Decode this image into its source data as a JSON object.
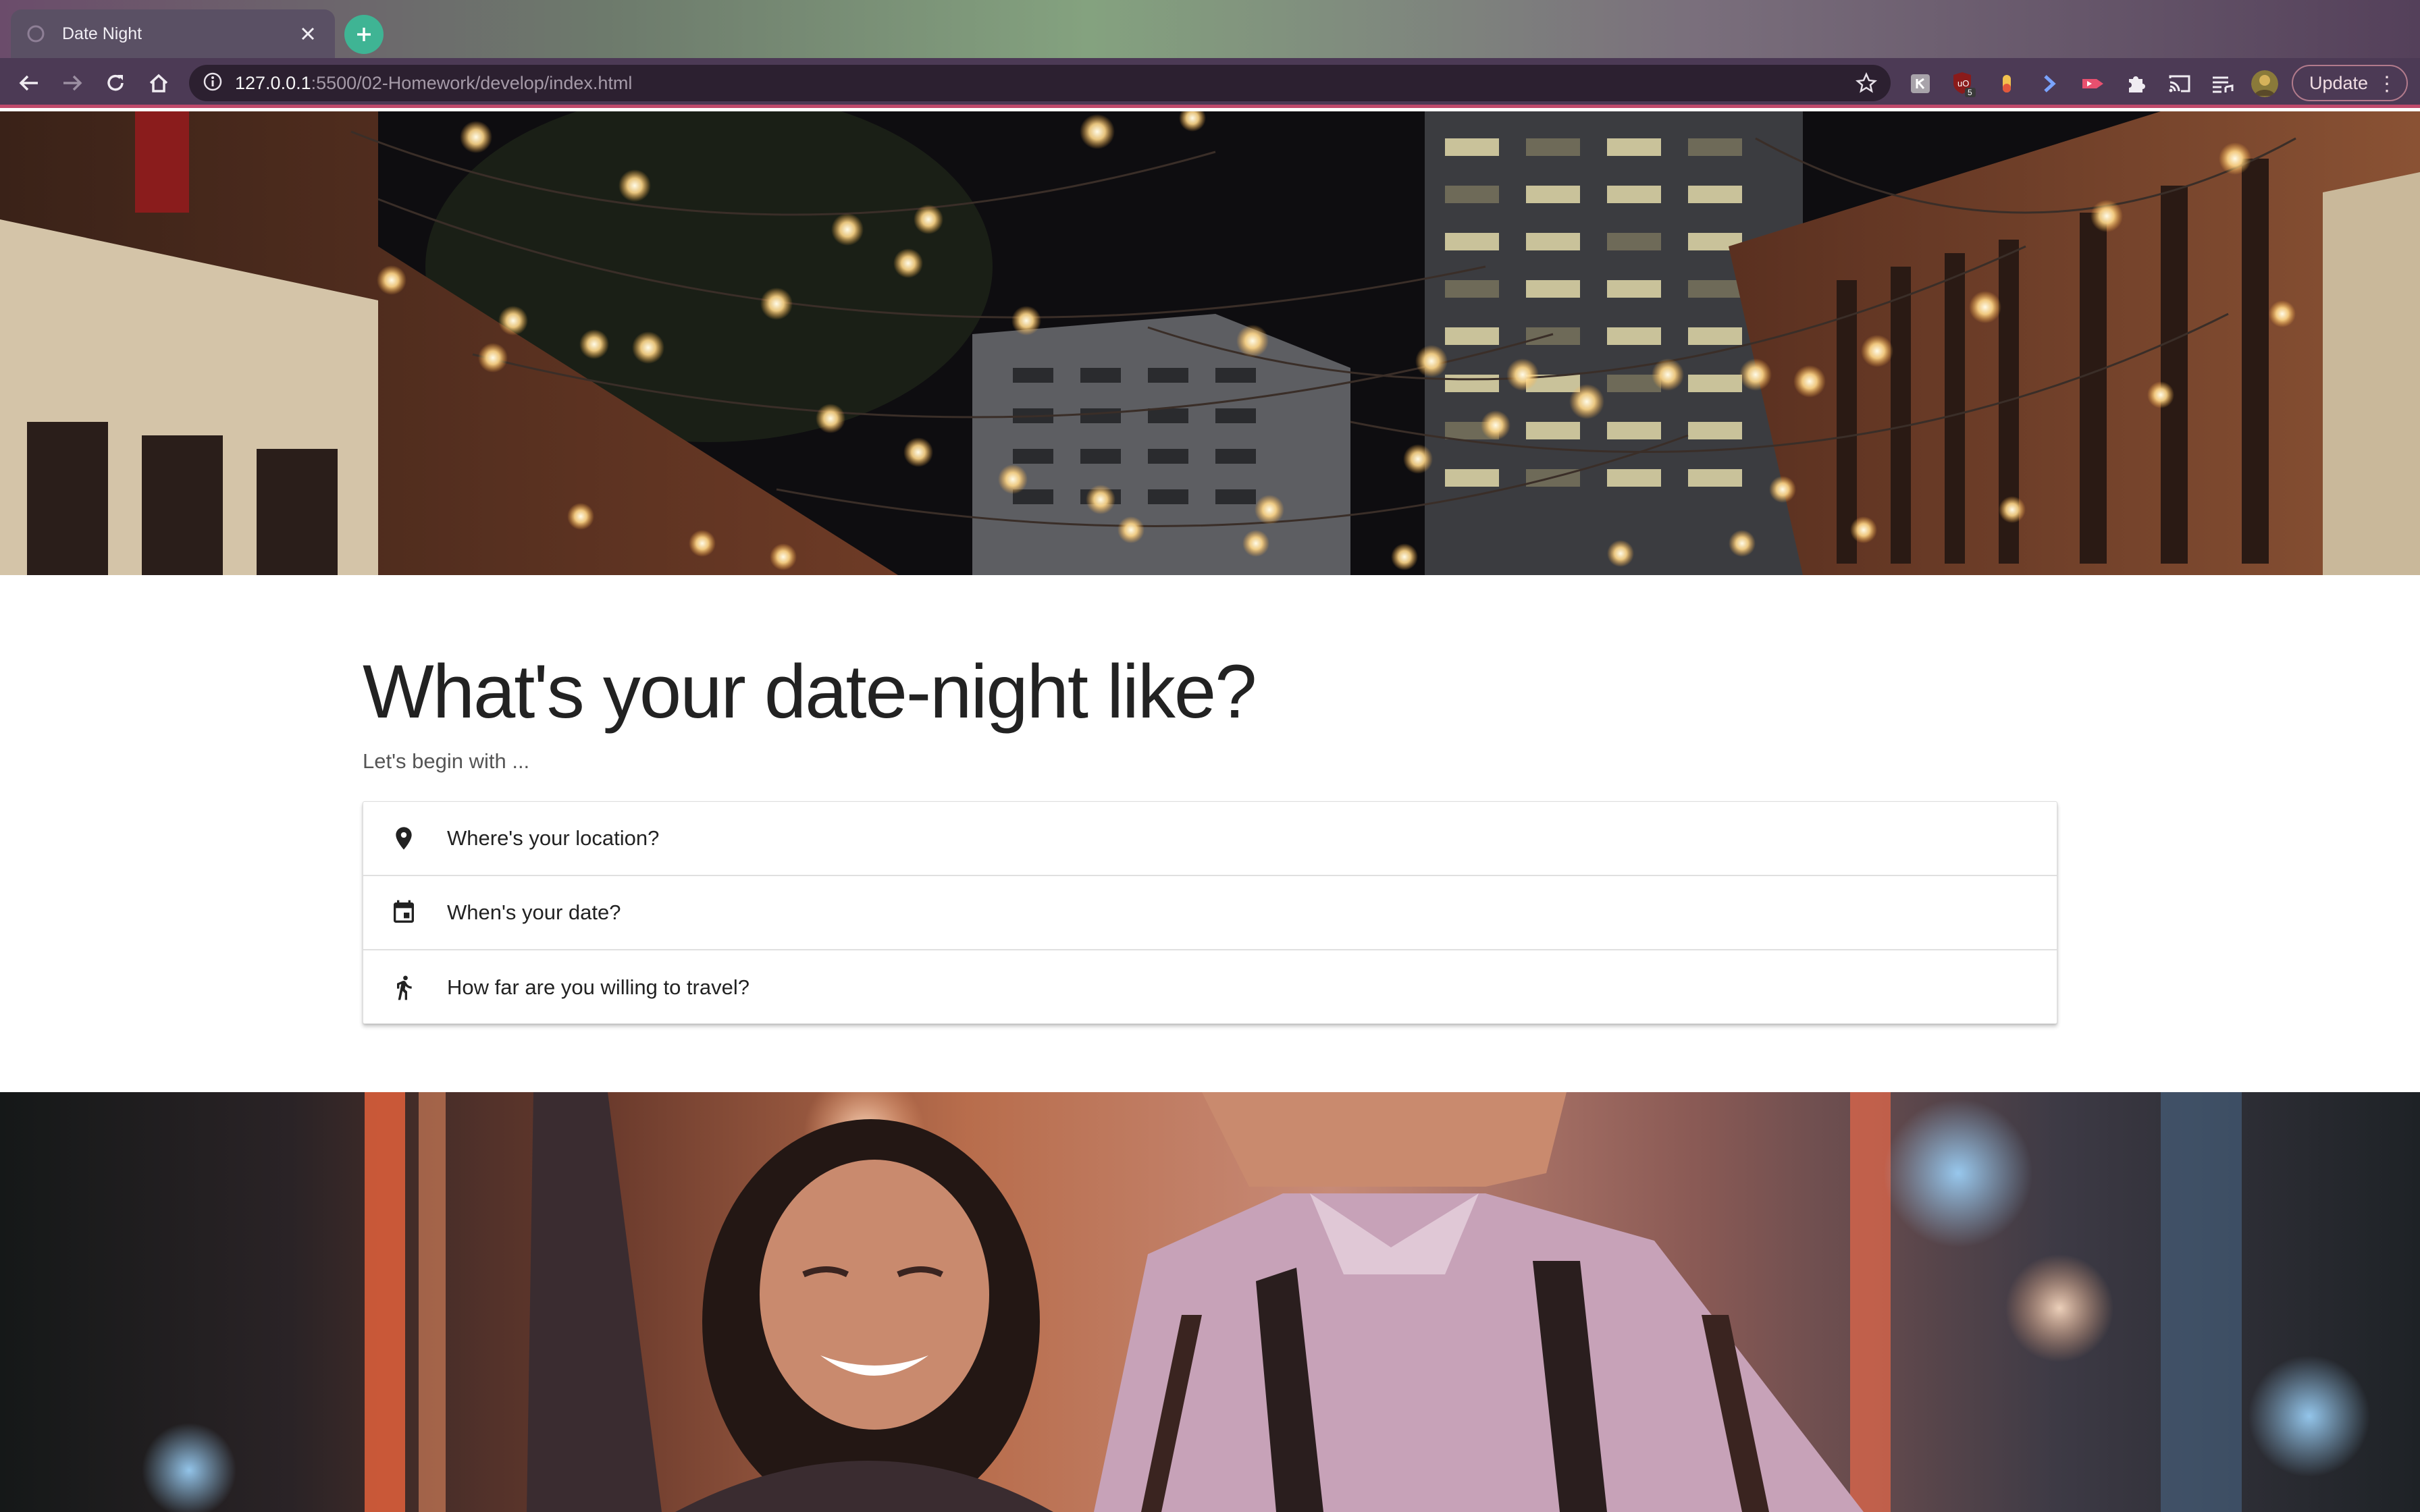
{
  "browser": {
    "tab_title": "Date Night",
    "url_host": "127.0.0.1",
    "url_path": ":5500/02-Homework/develop/index.html",
    "update_label": "Update",
    "extension_badge": "5",
    "accent_color": "#3fb494",
    "frame_color": "#4c3a55"
  },
  "hero_top": {
    "image": "string-lights-city-alley-night"
  },
  "main": {
    "title": "What's your date-night like?",
    "subtitle": "Let's begin with ...",
    "options": [
      {
        "icon": "location-pin-icon",
        "label": "Where's your location?"
      },
      {
        "icon": "calendar-icon",
        "label": "When's your date?"
      },
      {
        "icon": "walking-person-icon",
        "label": "How far are you willing to travel?"
      }
    ]
  },
  "hero_bottom": {
    "image": "couple-smiling-neon-lights"
  }
}
